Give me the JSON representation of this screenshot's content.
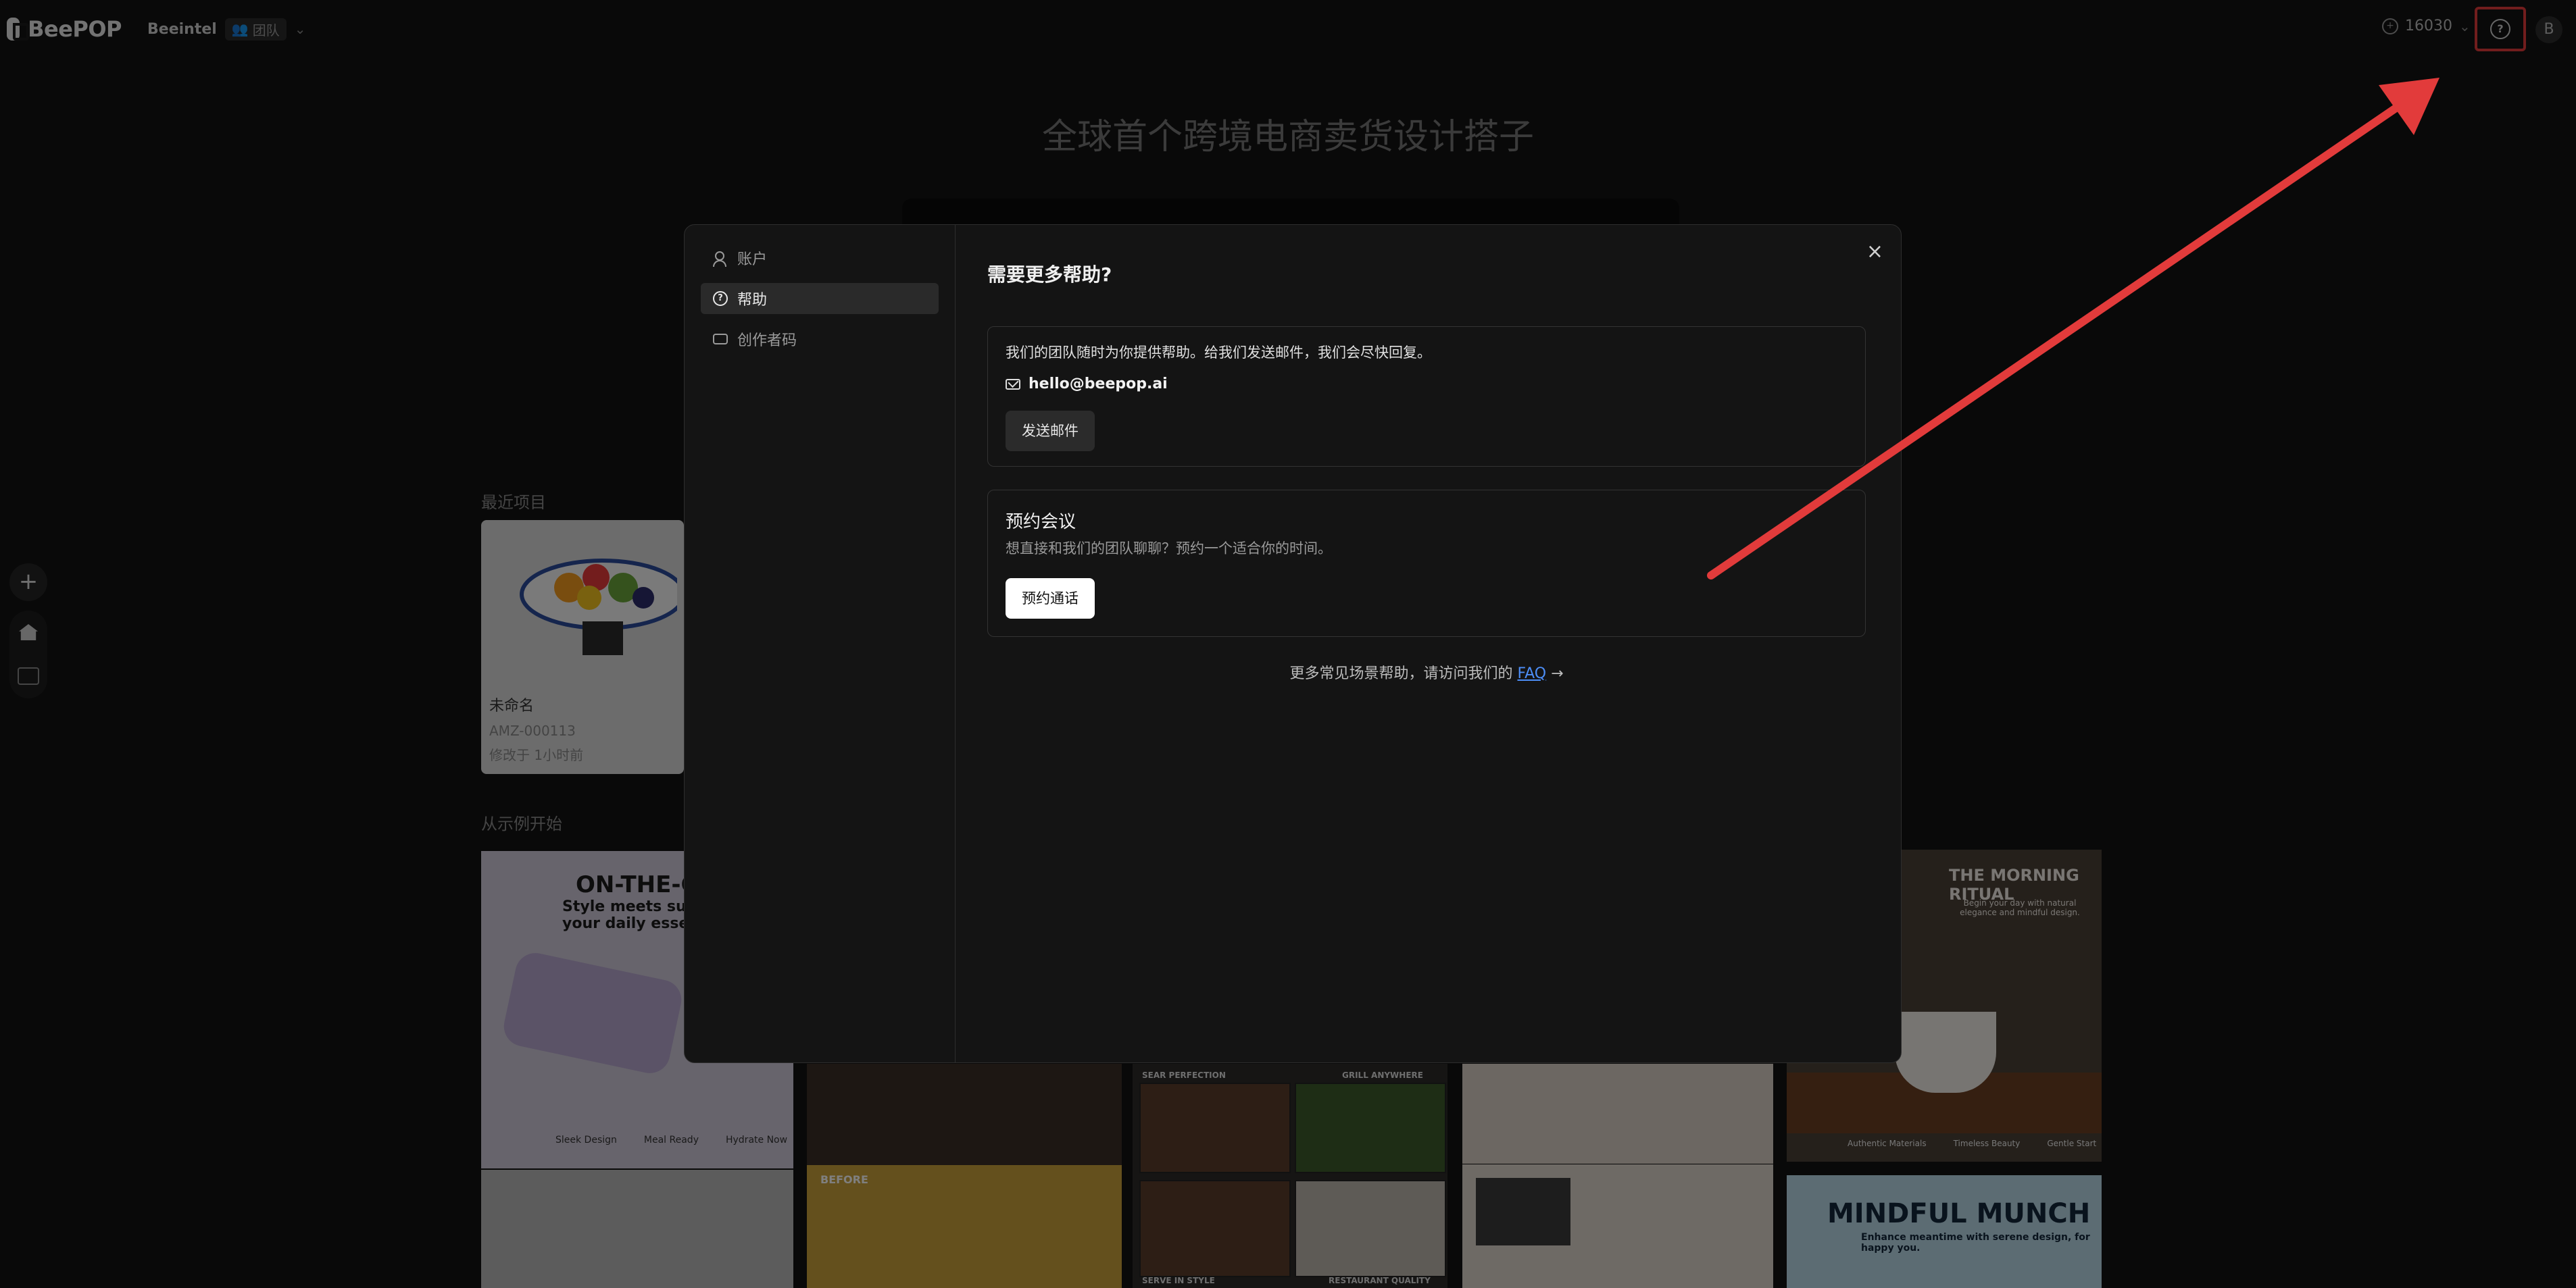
{
  "topbar": {
    "logo_text": "BeePOP",
    "team_name": "Beeintel",
    "team_badge": "团队",
    "credits": "16030",
    "avatar_initial": "B"
  },
  "page": {
    "hero_title": "全球首个跨境电商卖货设计搭子",
    "recent_label": "最近项目",
    "recent_project": {
      "name": "未命名",
      "code": "AMZ-000113",
      "edited": "修改于 1小时前"
    },
    "examples_label": "从示例开始",
    "examples": {
      "t1_title": "ON-THE-GO",
      "t1_sub": "Style meets substance your daily essentials",
      "t1_feats": [
        "Sleek Design",
        "Meal Ready",
        "Hydrate Now"
      ],
      "t3_caps": [
        "SEAR PERFECTION",
        "GRILL ANYWHERE",
        "SERVE IN STYLE",
        "RESTAURANT QUALITY"
      ],
      "t2_badge": "BEFORE",
      "t5_title": "THE MORNING RITUAL",
      "t5_sub": "Begin your day with natural elegance and mindful design.",
      "t5_feats": [
        "Authentic Materials",
        "Timeless Beauty",
        "Gentle Start"
      ],
      "t6_title": "MINDFUL MUNCH",
      "t6_sub": "Enhance meantime with serene design, for happy you."
    }
  },
  "modal": {
    "nav": [
      {
        "label": "账户"
      },
      {
        "label": "帮助"
      },
      {
        "label": "创作者码"
      }
    ],
    "title": "需要更多帮助?",
    "email_card": {
      "text": "我们的团队随时为你提供帮助。给我们发送邮件，我们会尽快回复。",
      "email": "hello@beepop.ai",
      "button": "发送邮件"
    },
    "meeting_card": {
      "title": "预约会议",
      "subtitle": "想直接和我们的团队聊聊？预约一个适合你的时间。",
      "button": "预约通话"
    },
    "faq_prefix": "更多常见场景帮助，请访问我们的",
    "faq_link": "FAQ",
    "faq_arrow": "→",
    "close": "×"
  },
  "colors": {
    "accent_red": "#e23b3b",
    "link_blue": "#4d8ef7"
  }
}
